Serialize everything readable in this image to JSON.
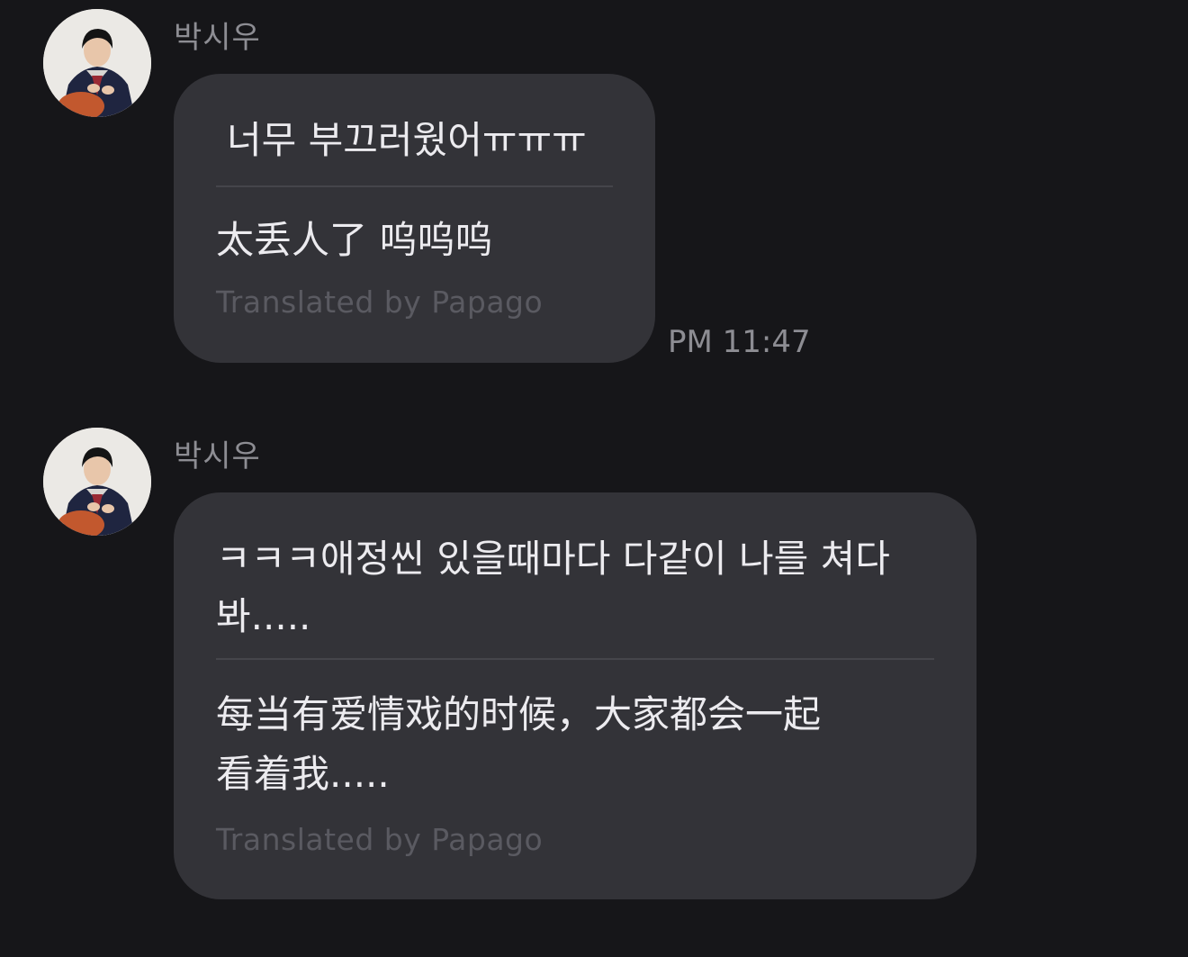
{
  "messages": [
    {
      "sender": "박시우",
      "original": "너무 부끄러웠어ㅠㅠㅠ",
      "translation": "太丢人了 呜呜呜",
      "credit": "Translated by Papago",
      "time": "PM 11:47"
    },
    {
      "sender": "박시우",
      "original": "ㅋㅋㅋ애정씬 있을때마다 다같이 나를 쳐다 봐.....",
      "translation": "每当有爱情戏的时候，大家都会一起 看着我.....",
      "credit": "Translated by Papago"
    }
  ],
  "colors": {
    "background": "#161619",
    "bubble": "#333338",
    "text": "#ecebef",
    "meta": "#8d8d93",
    "credit": "#5a5a61"
  }
}
